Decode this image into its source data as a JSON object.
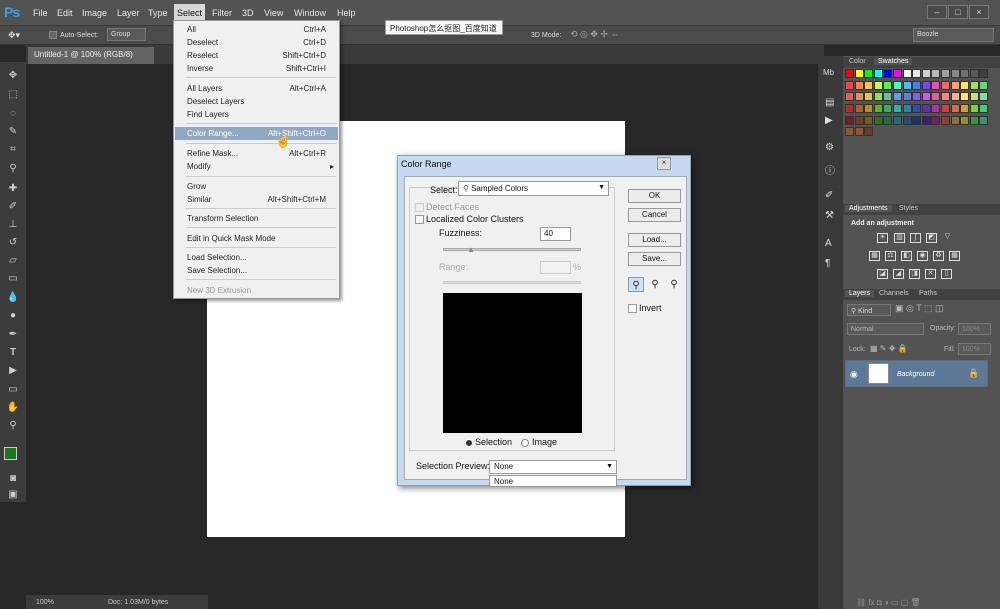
{
  "app": {
    "logo": "Ps"
  },
  "menubar": {
    "items": [
      "File",
      "Edit",
      "Image",
      "Layer",
      "Type",
      "Select",
      "Filter",
      "3D",
      "View",
      "Window",
      "Help"
    ],
    "window_buttons": [
      "–",
      "□",
      "×"
    ]
  },
  "tooltip": "Photoshop怎么抠图_百度知道",
  "options": {
    "auto_select": "Auto-Select:",
    "group": "Group",
    "mode_3d": "3D Mode:",
    "workspace": "Boozle"
  },
  "document": {
    "tab": "Untitled-1 @ 100% (RGB/8)",
    "zoom": "100%",
    "doc_info": "Doc: 1.03M/0 bytes"
  },
  "select_menu": {
    "items": [
      {
        "label": "All",
        "shortcut": "Ctrl+A"
      },
      {
        "label": "Deselect",
        "shortcut": "Ctrl+D"
      },
      {
        "label": "Reselect",
        "shortcut": "Shift+Ctrl+D"
      },
      {
        "label": "Inverse",
        "shortcut": "Shift+Ctrl+I"
      },
      {
        "label": "All Layers",
        "shortcut": "Alt+Ctrl+A"
      },
      {
        "label": "Deselect Layers",
        "shortcut": ""
      },
      {
        "label": "Find Layers",
        "shortcut": ""
      },
      {
        "label": "Color Range...",
        "shortcut": "Alt+Shift+Ctrl+O"
      },
      {
        "label": "Refine Mask...",
        "shortcut": "Alt+Ctrl+R"
      },
      {
        "label": "Modify",
        "shortcut": "▸"
      },
      {
        "label": "Grow",
        "shortcut": ""
      },
      {
        "label": "Similar",
        "shortcut": "Alt+Shift+Ctrl+M"
      },
      {
        "label": "Transform Selection",
        "shortcut": ""
      },
      {
        "label": "Edit in Quick Mask Mode",
        "shortcut": ""
      },
      {
        "label": "Load Selection...",
        "shortcut": ""
      },
      {
        "label": "Save Selection...",
        "shortcut": ""
      },
      {
        "label": "New 3D Extrusion",
        "shortcut": ""
      }
    ]
  },
  "dialog": {
    "title": "Color Range",
    "close": "×",
    "select_label": "Select:",
    "select_value": "Sampled Colors",
    "detect_faces": "Detect Faces",
    "localized": "Localized Color Clusters",
    "fuzziness_label": "Fuzziness:",
    "fuzziness_value": "40",
    "range_label": "Range:",
    "range_unit": "%",
    "radio_selection": "Selection",
    "radio_image": "Image",
    "preview_label": "Selection Preview:",
    "preview_value": "None",
    "preview_option": "None",
    "ok": "OK",
    "cancel": "Cancel",
    "load": "Load...",
    "save": "Save...",
    "invert": "Invert"
  },
  "panels": {
    "color_tab": "Color",
    "swatches_tab": "Swatches",
    "adjustments_tab": "Adjustments",
    "styles_tab": "Styles",
    "add_adjustment": "Add an adjustment",
    "layers_tab": "Layers",
    "channels_tab": "Channels",
    "paths_tab": "Paths",
    "kind": "Kind",
    "blend_mode": "Normal",
    "opacity_label": "Opacity:",
    "opacity_value": "100%",
    "lock_label": "Lock:",
    "fill_label": "Fill:",
    "fill_value": "100%",
    "layer_name": "Background"
  },
  "colors": {
    "fg": "#1a7a1a",
    "bg": "#ffffff",
    "highlight": "#91a8c5"
  },
  "swatch_colors": [
    "#ff0000",
    "#ffff00",
    "#00ff00",
    "#00ffff",
    "#0000ff",
    "#ff00ff",
    "#ffffff",
    "#e8e8e8",
    "#d0d0d0",
    "#b8b8b8",
    "#a0a0a0",
    "#888888",
    "#707070",
    "#585858",
    "#404040",
    "#ff4040",
    "#ff8040",
    "#ffc040",
    "#c0ff40",
    "#40ff40",
    "#40ffc0",
    "#40c0ff",
    "#4080ff",
    "#8040ff",
    "#ff40c0",
    "#ff6060",
    "#ffa060",
    "#ffe060",
    "#a0e060",
    "#60e060",
    "#e06060",
    "#e09060",
    "#e0c060",
    "#90e060",
    "#60c0a0",
    "#60a0e0",
    "#6080e0",
    "#8060e0",
    "#c060e0",
    "#e06090",
    "#ff8080",
    "#ffb080",
    "#ffe080",
    "#c0e080",
    "#80e0a0",
    "#b03030",
    "#b06030",
    "#b09030",
    "#60b030",
    "#30b060",
    "#30b0b0",
    "#3080b0",
    "#3050b0",
    "#6030b0",
    "#b030a0",
    "#d04040",
    "#d07040",
    "#d0a040",
    "#80d040",
    "#40d080",
    "#702020",
    "#704020",
    "#706020",
    "#307020",
    "#207040",
    "#207070",
    "#205070",
    "#203070",
    "#402070",
    "#702060",
    "#904030",
    "#907040",
    "#909040",
    "#409040",
    "#409070",
    "#8b5a2b",
    "#a0522d",
    "#6b3e1f"
  ]
}
